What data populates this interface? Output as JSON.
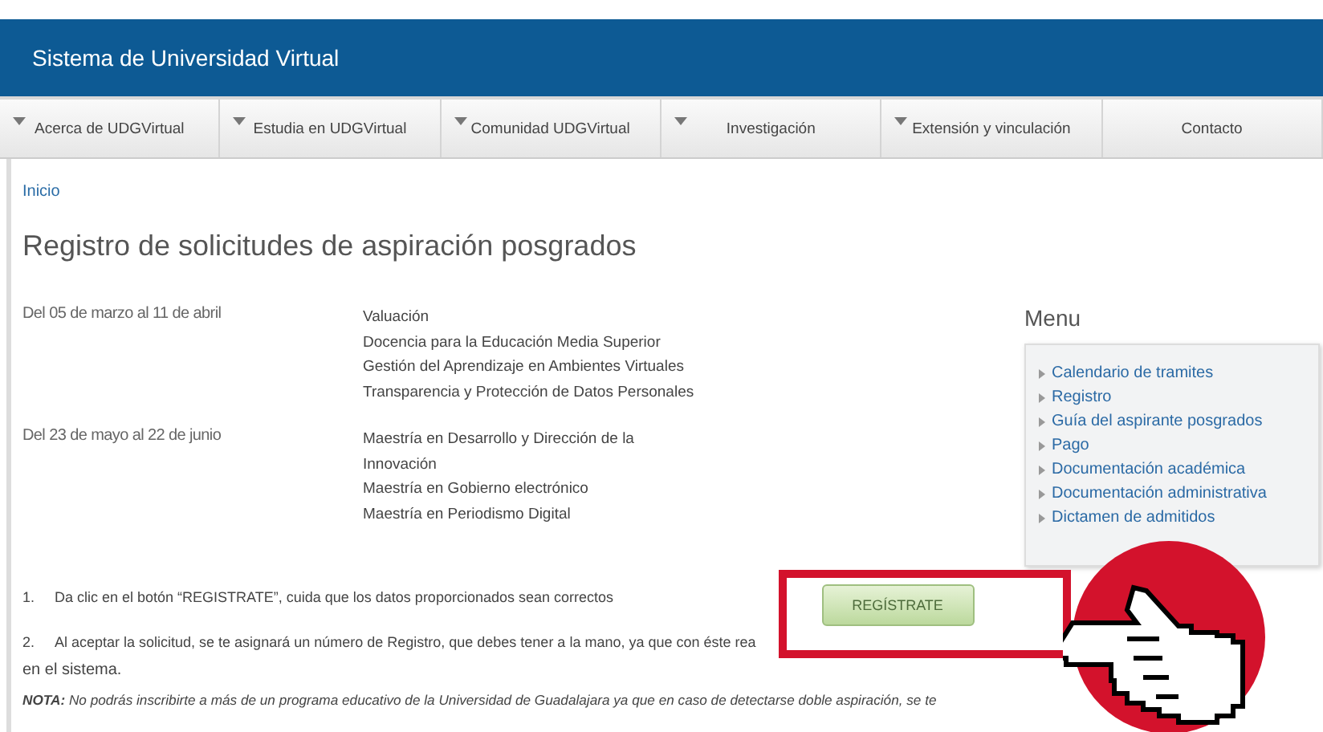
{
  "header": {
    "title": "Sistema de Universidad Virtual"
  },
  "nav": [
    {
      "label": "Acerca de UDGVirtual",
      "dropdown": true
    },
    {
      "label": "Estudia en UDGVirtual",
      "dropdown": true
    },
    {
      "label": "Comunidad UDGVirtual",
      "dropdown": true
    },
    {
      "label": "Investigación",
      "dropdown": true
    },
    {
      "label": "Extensión y vinculación",
      "dropdown": true
    },
    {
      "label": "Contacto",
      "dropdown": false
    }
  ],
  "breadcrumb": "Inicio",
  "page_title": "Registro de solicitudes de aspiración posgrados",
  "periods": [
    {
      "dates": "Del 05 de marzo al 11 de abril",
      "programs": [
        "Valuación",
        "Docencia para la Educación Media Superior",
        "Gestión del Aprendizaje en Ambientes Virtuales",
        "Transparencia y Protección de Datos Personales"
      ]
    },
    {
      "dates": "Del 23 de mayo al 22 de junio",
      "programs": [
        "Maestría en Desarrollo y Dirección de la Innovación",
        "Maestría en Gobierno electrónico",
        "Maestría en Periodismo Digital"
      ]
    }
  ],
  "menu": {
    "title": "Menu",
    "items": [
      "Calendario de tramites",
      "Registro",
      "Guía del aspirante posgrados",
      "Pago",
      "Documentación académica",
      "Documentación administrativa",
      "Dictamen de admitidos"
    ]
  },
  "steps": [
    {
      "number": "1.",
      "text": "Da clic en el botón “REGISTRATE”,  cuida que los datos proporcionados sean correctos"
    },
    {
      "number": "2.",
      "text": "Al aceptar la solicitud, se te asignará un número de Registro, que debes tener a la mano, ya que con éste rea",
      "continuation": "en el sistema."
    }
  ],
  "register_button": "REGÍSTRATE",
  "note": "**NOTA:** No podrás inscribirte a más de un programa educativo de la Universidad de Guadalajara ya que en caso de detectarse doble aspiración, se te"
}
